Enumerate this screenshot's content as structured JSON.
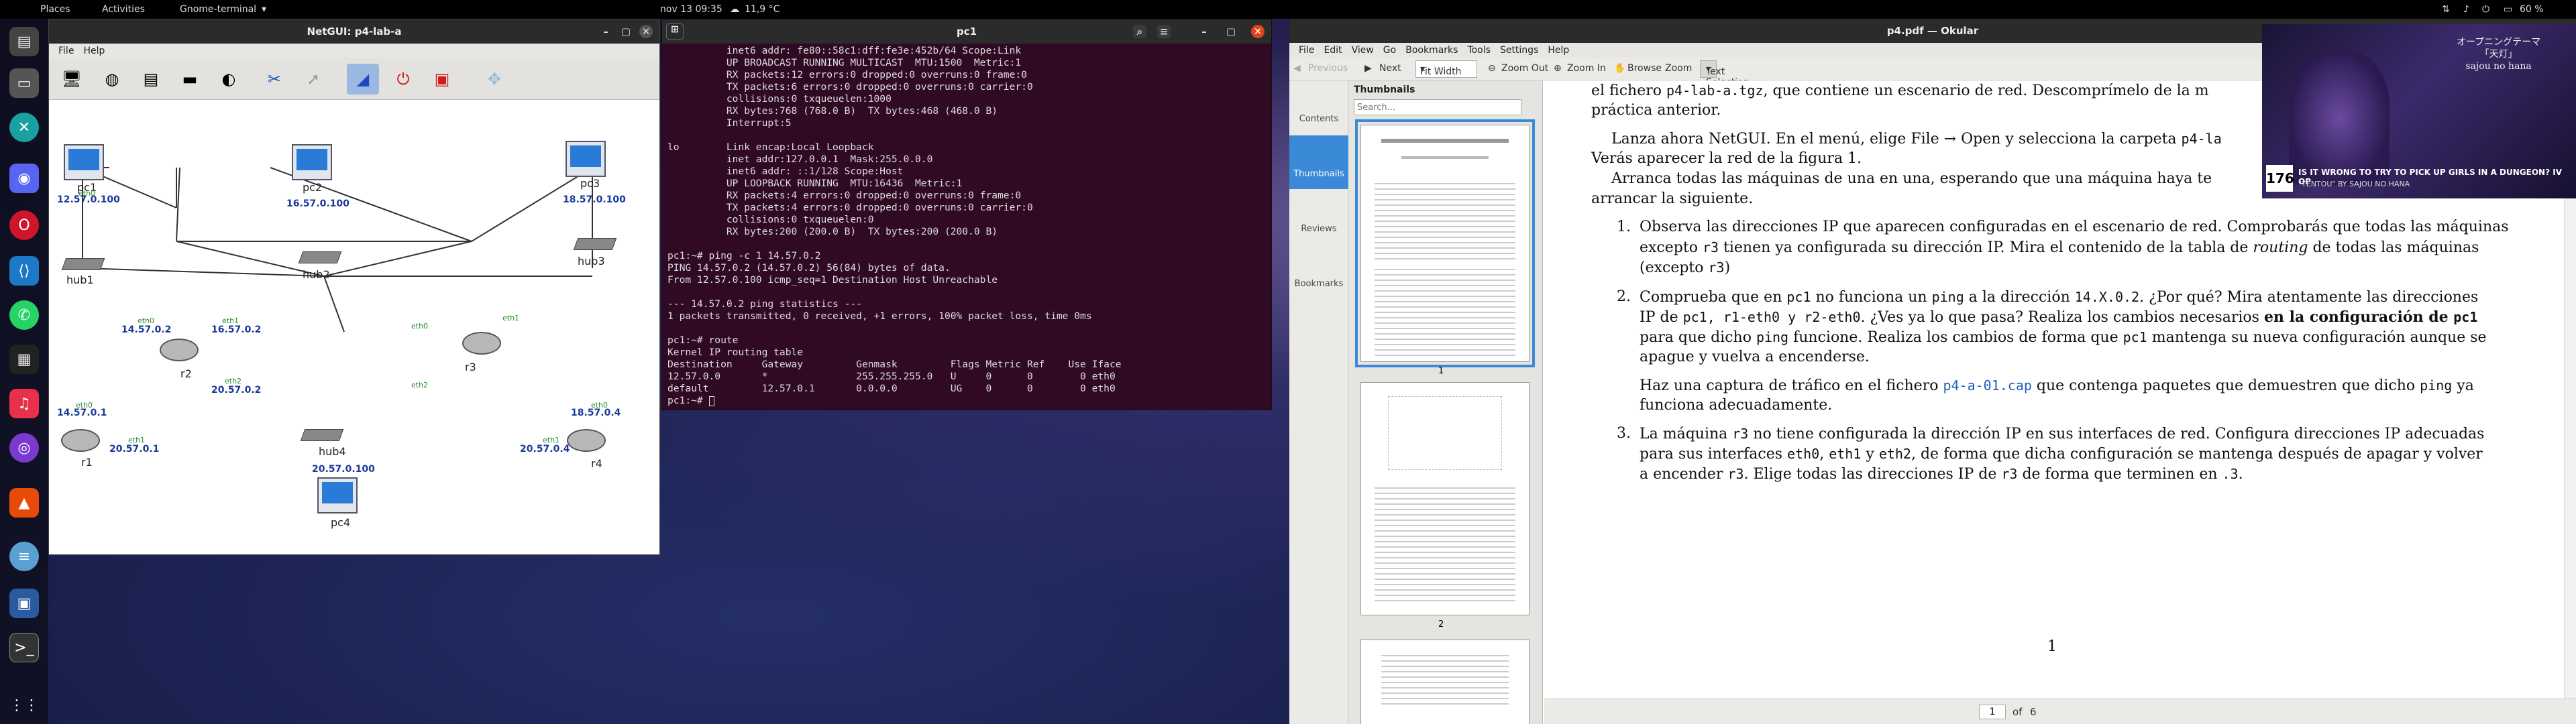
{
  "topbar": {
    "places": "Places",
    "activities": "Activities",
    "app_menu": "Gnome-terminal",
    "datetime": "nov 13  09:35",
    "weather": "11,9 °C",
    "battery": "60 %"
  },
  "netgui": {
    "title": "NetGUI: p4-lab-a",
    "menu": [
      "File",
      "Help"
    ],
    "nodes": {
      "pc1": "pc1",
      "pc2": "pc2",
      "pc3": "pc3",
      "pc4": "pc4",
      "hub1": "hub1",
      "hub2": "hub2",
      "hub3": "hub3",
      "hub4": "hub4",
      "r1": "r1",
      "r2": "r2",
      "r3": "r3",
      "r4": "r4"
    },
    "ips": {
      "pc1": "12.57.0.100",
      "pc2": "16.57.0.100",
      "pc3": "18.57.0.100",
      "pc4": "20.57.0.100",
      "r2_eth0": "14.57.0.2",
      "r2_eth1": "16.57.0.2",
      "r2_eth2": "20.57.0.2",
      "r1_eth0": "14.57.0.1",
      "r1_eth1": "20.57.0.1",
      "r4_eth0": "18.57.0.4",
      "r4_eth1": "20.57.0.4"
    },
    "eth_labels": [
      "eth0",
      "eth1",
      "eth2"
    ]
  },
  "terminal": {
    "title": "pc1",
    "lines": [
      "          inet6 addr: fe80::58c1:dff:fe3e:452b/64 Scope:Link",
      "          UP BROADCAST RUNNING MULTICAST  MTU:1500  Metric:1",
      "          RX packets:12 errors:0 dropped:0 overruns:0 frame:0",
      "          TX packets:6 errors:0 dropped:0 overruns:0 carrier:0",
      "          collisions:0 txqueuelen:1000",
      "          RX bytes:768 (768.0 B)  TX bytes:468 (468.0 B)",
      "          Interrupt:5",
      "",
      "lo        Link encap:Local Loopback",
      "          inet addr:127.0.0.1  Mask:255.0.0.0",
      "          inet6 addr: ::1/128 Scope:Host",
      "          UP LOOPBACK RUNNING  MTU:16436  Metric:1",
      "          RX packets:4 errors:0 dropped:0 overruns:0 frame:0",
      "          TX packets:4 errors:0 dropped:0 overruns:0 carrier:0",
      "          collisions:0 txqueuelen:0",
      "          RX bytes:200 (200.0 B)  TX bytes:200 (200.0 B)",
      "",
      "pc1:~# ping -c 1 14.57.0.2",
      "PING 14.57.0.2 (14.57.0.2) 56(84) bytes of data.",
      "From 12.57.0.100 icmp_seq=1 Destination Host Unreachable",
      "",
      "--- 14.57.0.2 ping statistics ---",
      "1 packets transmitted, 0 received, +1 errors, 100% packet loss, time 0ms",
      "",
      "pc1:~# route",
      "Kernel IP routing table",
      "Destination     Gateway         Genmask         Flags Metric Ref    Use Iface",
      "12.57.0.0       *               255.255.255.0   U     0      0        0 eth0",
      "default         12.57.0.1       0.0.0.0         UG    0      0        0 eth0",
      "pc1:~# "
    ]
  },
  "okular": {
    "title": "p4.pdf — Okular",
    "menu": [
      "File",
      "Edit",
      "View",
      "Go",
      "Bookmarks",
      "Tools",
      "Settings",
      "Help"
    ],
    "toolbar": {
      "previous": "Previous",
      "next": "Next",
      "zoom_mode": "Fit Width",
      "zoom_out": "Zoom Out",
      "zoom_in": "Zoom In",
      "browse": "Browse",
      "zoom": "Zoom",
      "text_selection": "Text Selection"
    },
    "side_tabs": [
      "Contents",
      "Thumbnails",
      "Reviews",
      "Bookmarks"
    ],
    "thumbnails_header": "Thumbnails",
    "search_placeholder": "Search...",
    "thumb_numbers": [
      "1",
      "2"
    ],
    "page_number": "1",
    "page_of": "of",
    "page_total": "6",
    "content": {
      "line1a": "el fichero ",
      "line1_file": "p4-lab-a.tgz",
      "line1b": ", que contiene un escenario de red. Descomprímelo de la m",
      "line2": "práctica anterior.",
      "p2a": "Lanza ahora NetGUI. En el menú, elige File → Open y selecciona la carpeta ",
      "p2_folder": "p4-la",
      "p2b": "Verás aparecer la red de la figura 1.",
      "p3a": "Arranca todas las máquinas de una en una, esperando que una máquina haya te",
      "p3b": "arrancar la siguiente.",
      "i1": "1.",
      "i1a": "Observa las direcciones IP que aparecen configuradas en el escenario de red. Comprobarás que todas las máquinas",
      "i1b_pre": "excepto ",
      "i1b_code": "r3",
      "i1b_post": " tienen ya configurada su dirección IP. Mira el contenido de la tabla de ",
      "i1b_em": "routing",
      "i1b_end": " de todas las máquinas",
      "i1c_pre": "(excepto ",
      "i1c_code": "r3",
      "i1c_post": ")",
      "i2": "2.",
      "i2a_pre": "Comprueba que en ",
      "i2a_c1": "pc1",
      "i2a_m": " no funciona un ",
      "i2a_c2": "ping",
      "i2a_m2": " a la dirección ",
      "i2a_c3": "14.X.0.2",
      "i2a_end": ". ¿Por qué? Mira atentamente las direcciones",
      "i2b_pre": "IP de ",
      "i2b_c": "pc1, r1-eth0 y r2-eth0",
      "i2b_m": ". ¿Ves ya lo que pasa? Realiza los cambios necesarios ",
      "i2b_bold": "en la configuración de ",
      "i2b_bold_code": "pc1",
      "i2c_pre": "para que dicho ",
      "i2c_code": "ping",
      "i2c_m": " funcione. Realiza los cambios de forma que ",
      "i2c_code2": "pc1",
      "i2c_end": " mantenga su nueva configuración aunque se",
      "i2d": "apague y vuelva a encenderse.",
      "i2e_pre": "Haz una captura de tráfico en el fichero ",
      "i2e_link": "p4-a-01.cap",
      "i2e_end": " que contenga paquetes que demuestren que dicho ",
      "i2e_code": "ping",
      "i2e_end2": " ya",
      "i2f": "funciona adecuadamente.",
      "i3": "3.",
      "i3a_pre": "La máquina ",
      "i3a_code": "r3",
      "i3a_end": " no tiene configurada la dirección IP en sus interfaces de red. Configura direcciones IP adecuadas",
      "i3b_pre": "para sus interfaces ",
      "i3b_c1": "eth0",
      "i3b_m1": ", ",
      "i3b_c2": "eth1",
      "i3b_m2": " y ",
      "i3b_c3": "eth2",
      "i3b_end": ", de forma que dicha configuración se mantenga después de apagar y volver",
      "i3c_pre": "a encender ",
      "i3c_code": "r3",
      "i3c_m": ". Elige todas las direcciones IP de ",
      "i3c_code2": "r3",
      "i3c_m2": " de forma que terminen en ",
      "i3c_code3": ".3",
      "i3c_end": ".",
      "page_footer": "1"
    }
  },
  "video": {
    "badge": "176",
    "line1": "IS IT WRONG TO TRY TO PICK UP GIRLS IN A DUNGEON? IV OP",
    "line2": "\"TENTOU\" BY SAJOU NO HANA",
    "jp1": "オープニングテーマ",
    "jp2": "「天灯」",
    "jp3": "sajou no hana"
  },
  "colors": {
    "terminal_bg": "#300a24",
    "ip_blue": "#1a3a9a",
    "link_blue": "#1f5fbf"
  }
}
